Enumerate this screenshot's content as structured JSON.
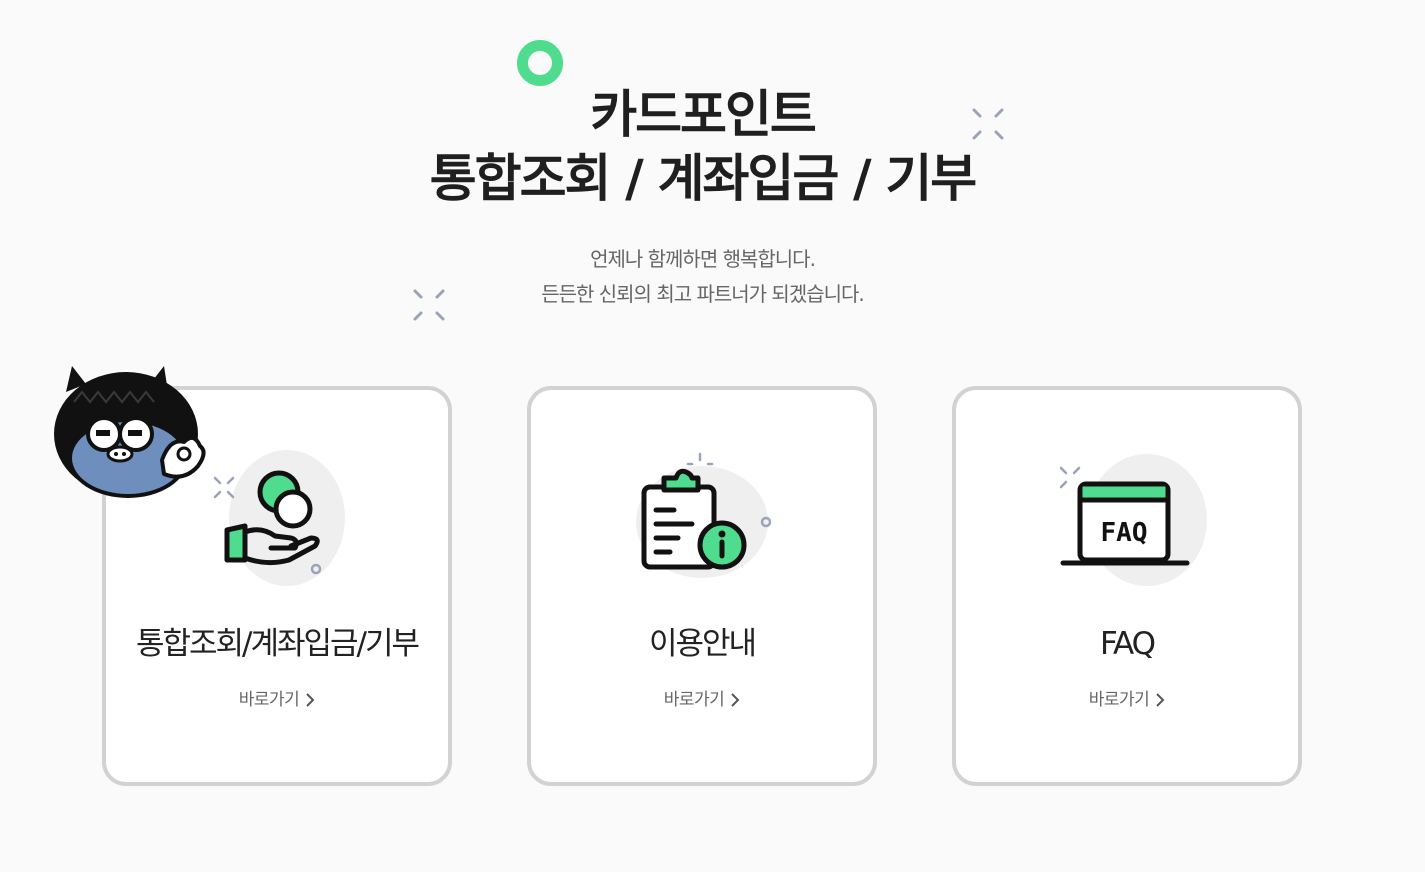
{
  "header": {
    "title_line1": "카드포인트",
    "title_line2": "통합조회 / 계좌입금 / 기부",
    "subtitle_line1": "언제나 함께하면 행복합니다.",
    "subtitle_line2": "든든한 신뢰의 최고 파트너가 되겠습니다."
  },
  "colors": {
    "accent_green": "#4fdc8f",
    "card_border": "#d2d2d2",
    "background": "#fafafa"
  },
  "cards": [
    {
      "title": "통합조회/계좌입금/기부",
      "link_label": "바로가기",
      "icon": "coin-hand-icon"
    },
    {
      "title": "이용안내",
      "link_label": "바로가기",
      "icon": "clipboard-info-icon"
    },
    {
      "title": "FAQ",
      "link_label": "바로가기",
      "icon": "faq-board-icon",
      "icon_text": "FAQ"
    }
  ],
  "mascot": {
    "icon": "mascot-character-icon"
  }
}
